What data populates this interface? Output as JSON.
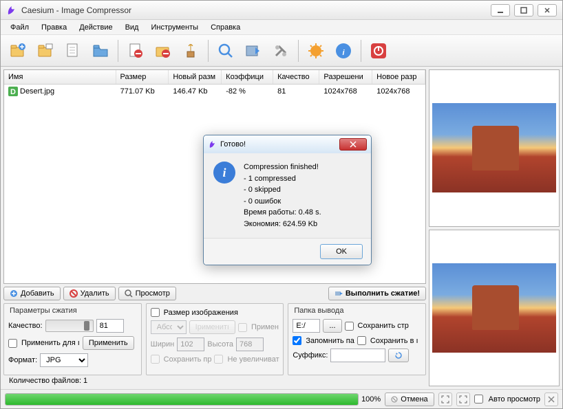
{
  "window": {
    "title": "Caesium - Image Compressor"
  },
  "menu": {
    "items": [
      "Файл",
      "Правка",
      "Действие",
      "Вид",
      "Инструменты",
      "Справка"
    ]
  },
  "table": {
    "headers": [
      "Имя",
      "Размер",
      "Новый разм",
      "Коэффици",
      "Качество",
      "Разрешени",
      "Новое разр"
    ],
    "rows": [
      {
        "name": "Desert.jpg",
        "size": "771.07 Kb",
        "newsize": "146.47 Kb",
        "ratio": "-82 %",
        "quality": "81",
        "res": "1024x768",
        "newres": "1024x768"
      }
    ]
  },
  "buttons": {
    "add": "Добавить",
    "remove": "Удалить",
    "preview": "Просмотр",
    "compress": "Выполнить сжатие!",
    "cancel": "Отмена",
    "apply": "Применить",
    "applyfor": "Применить для ı"
  },
  "params": {
    "compress_title": "Параметры сжатия",
    "quality_label": "Качество:",
    "quality_value": "81",
    "format_label": "Формат:",
    "format_value": "JPG",
    "resize_title": "Размер изображения",
    "absolute": "Абсолı",
    "apply_btn": "Iрименитı",
    "apply_chk": "Примен",
    "width_label": "Ширин",
    "width_value": "102",
    "height_label": "Высота",
    "height_value": "768",
    "keep_label": "Сохранить пр",
    "noenlarge_label": "Не увеличиват",
    "output_title": "Папка вывода",
    "output_path": "E:/",
    "keep_struct": "Сохранить стр",
    "remember": "Запомнить па",
    "keep_in": "Сохранить в ı",
    "suffix_label": "Суффикс:"
  },
  "status": {
    "files_count": "Количество файлов: 1",
    "progress_pct": "100%",
    "autopreview": "Авто просмотр"
  },
  "dialog": {
    "title": "Готово!",
    "body": "Compression finished!\n- 1 compressed\n- 0 skipped\n- 0 ошибок\nВремя работы: 0.48 s.\nЭкономия: 624.59 Kb",
    "ok": "OK"
  }
}
